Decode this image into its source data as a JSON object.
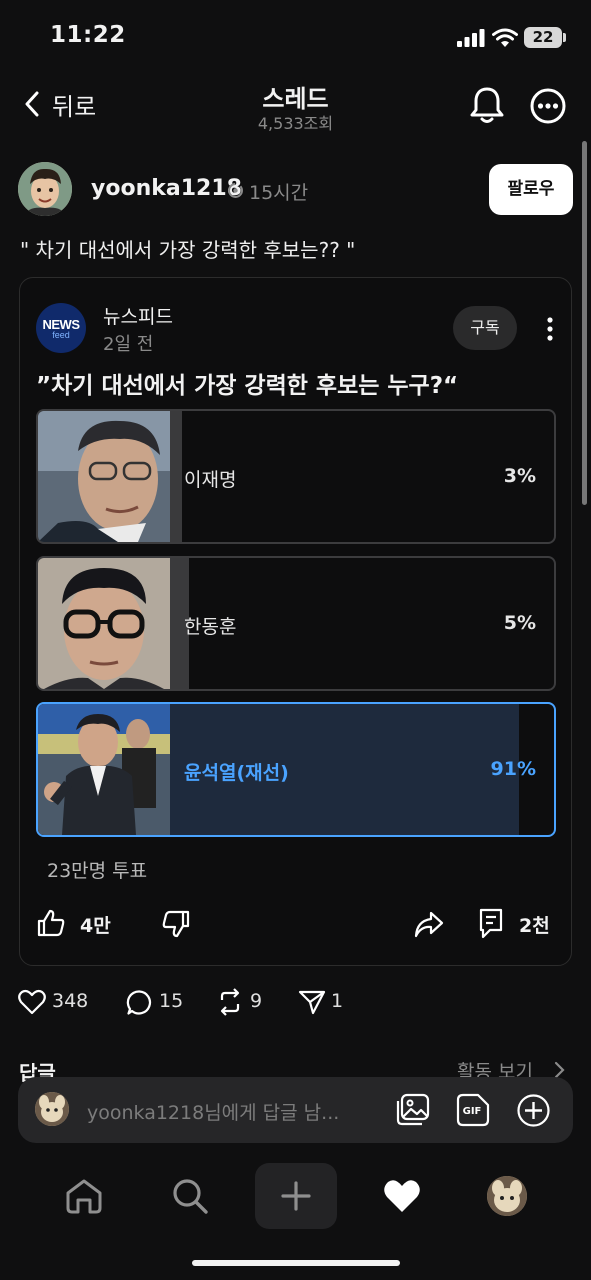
{
  "status_bar": {
    "time": "11:22",
    "battery": "22"
  },
  "nav": {
    "back_label": "뒤로",
    "title": "스레드",
    "views": "4,533조회"
  },
  "post": {
    "username": "yoonka1218",
    "time_ago": "15시간",
    "follow_label": "팔로우",
    "text": "\" 차기 대선에서 가장 강력한 후보는?? \""
  },
  "embed": {
    "logo_line1": "NEWS",
    "logo_line2": "feed",
    "source_name": "뉴스피드",
    "source_time": "2일 전",
    "subscribe_label": "구독",
    "title": "”차기 대선에서 가장 강력한 후보는 누구?“",
    "poll_options": [
      {
        "name": "이재명",
        "percent_label": "3%",
        "percent": 3,
        "selected": false
      },
      {
        "name": "한동훈",
        "percent_label": "5%",
        "percent": 5,
        "selected": false
      },
      {
        "name": "윤석열(재선)",
        "percent_label": "91%",
        "percent": 91,
        "selected": true
      }
    ],
    "vote_count": "23만명 투표",
    "likes": "4만",
    "comments": "2천"
  },
  "stats": {
    "likes": "348",
    "comments": "15",
    "reposts": "9",
    "shares": "1"
  },
  "replies": {
    "label": "답글",
    "activity_label": "활동 보기",
    "placeholder": "yoonka1218님에게 답글 남..."
  },
  "colors": {
    "accent": "#4aa3ff",
    "background": "#0f0f10"
  }
}
